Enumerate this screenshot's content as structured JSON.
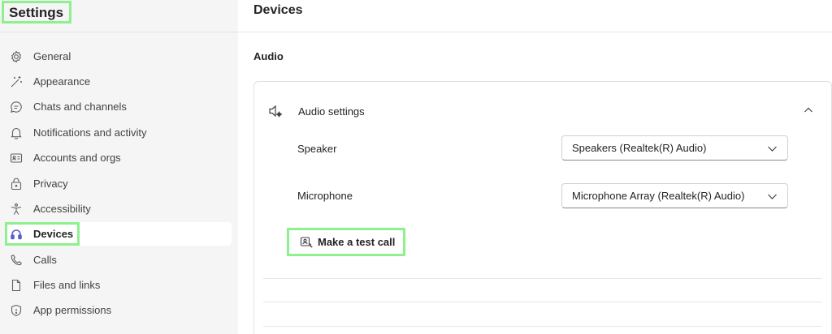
{
  "sidebar": {
    "title": "Settings",
    "items": [
      {
        "label": "General",
        "icon": "gear-icon"
      },
      {
        "label": "Appearance",
        "icon": "magic-wand-icon"
      },
      {
        "label": "Chats and channels",
        "icon": "chat-icon"
      },
      {
        "label": "Notifications and activity",
        "icon": "bell-icon"
      },
      {
        "label": "Accounts and orgs",
        "icon": "id-card-icon"
      },
      {
        "label": "Privacy",
        "icon": "lock-icon"
      },
      {
        "label": "Accessibility",
        "icon": "accessibility-icon"
      },
      {
        "label": "Devices",
        "icon": "headset-icon",
        "active": true
      },
      {
        "label": "Calls",
        "icon": "phone-icon"
      },
      {
        "label": "Files and links",
        "icon": "document-icon"
      },
      {
        "label": "App permissions",
        "icon": "shield-icon"
      }
    ]
  },
  "main": {
    "title": "Devices",
    "section": "Audio",
    "audio_card": {
      "header": "Audio settings",
      "speaker_label": "Speaker",
      "speaker_value": "Speakers (Realtek(R) Audio)",
      "microphone_label": "Microphone",
      "microphone_value": "Microphone Array (Realtek(R) Audio)",
      "test_call_label": "Make a test call"
    }
  },
  "colors": {
    "accent": "#5b5fc7",
    "highlight": "#8ff08f",
    "sidebar_bg": "#f5f5f5"
  }
}
